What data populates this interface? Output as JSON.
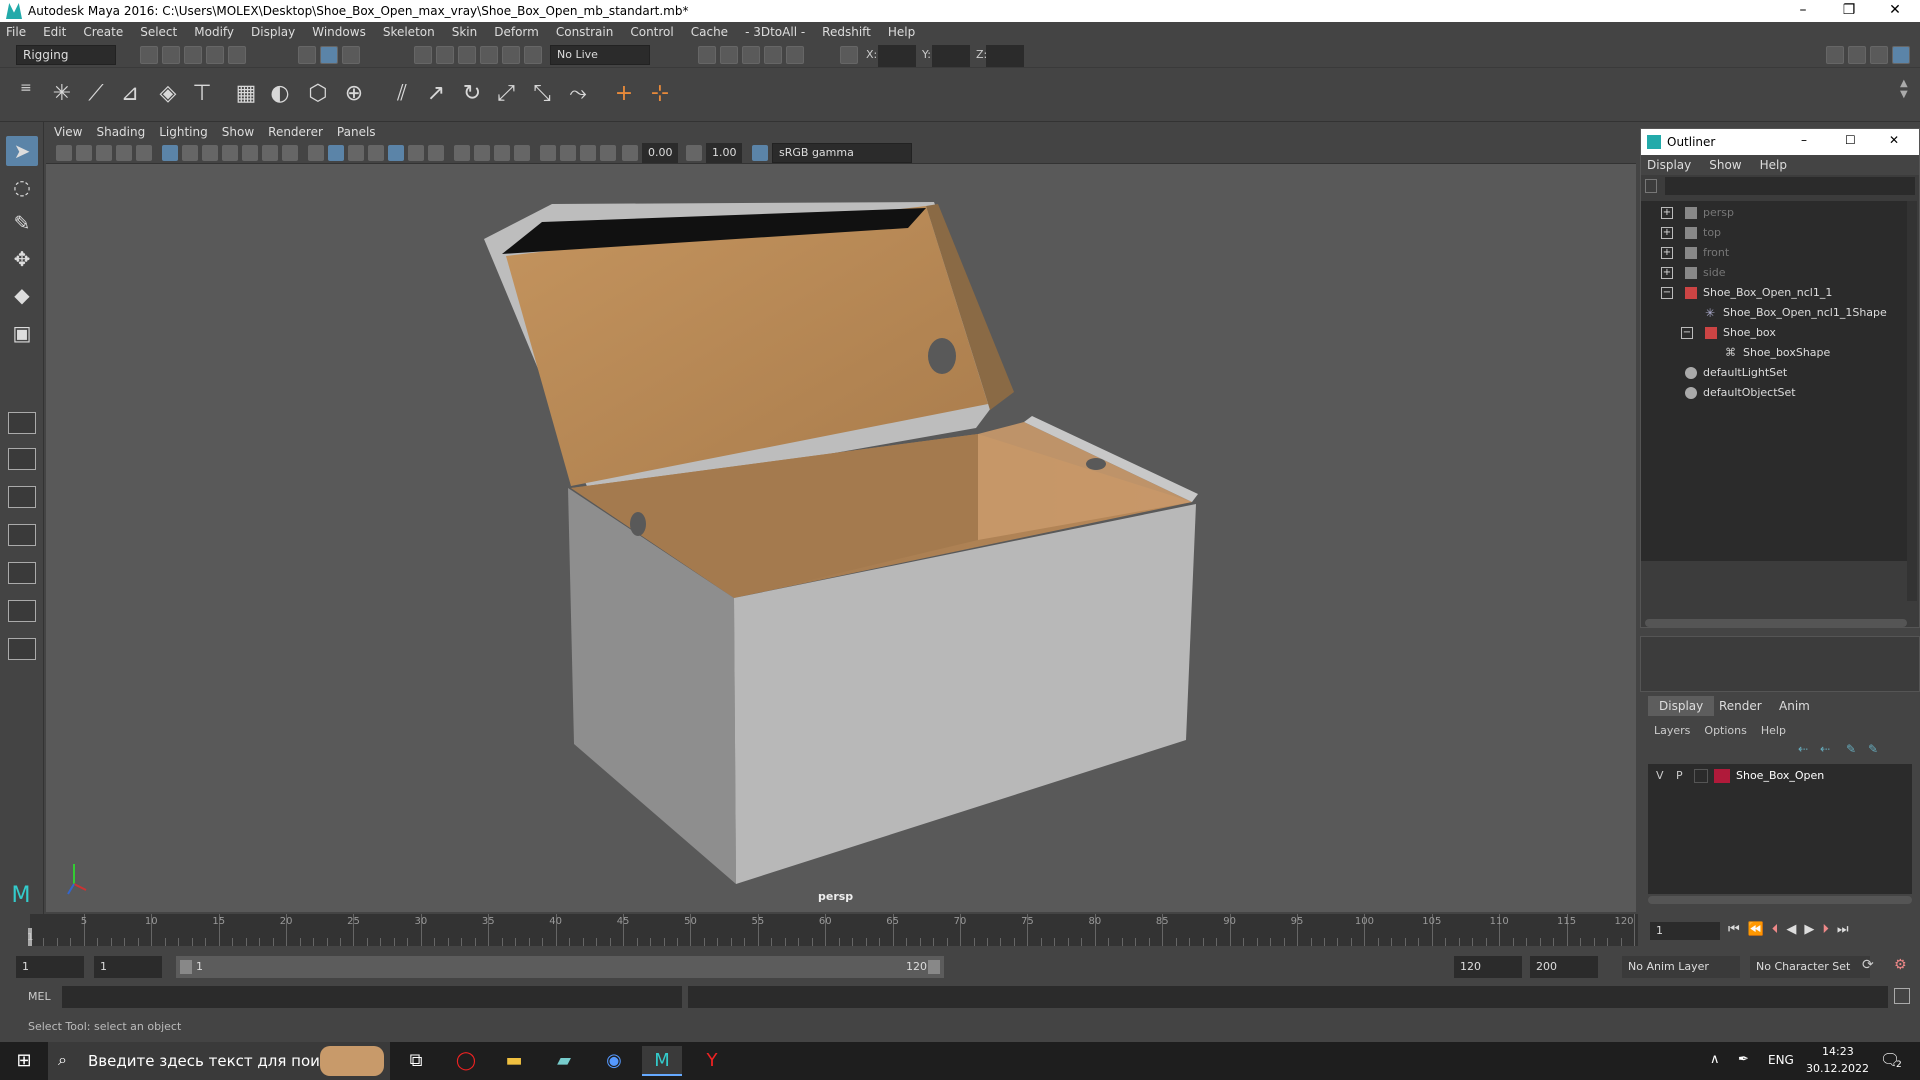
{
  "app": {
    "title": "Autodesk Maya 2016: C:\\Users\\MOLEX\\Desktop\\Shoe_Box_Open_max_vray\\Shoe_Box_Open_mb_standart.mb*",
    "min_icon": "minimize-icon",
    "max_icon": "restore-icon",
    "close_icon": "close-icon"
  },
  "menubar": [
    "File",
    "Edit",
    "Create",
    "Select",
    "Modify",
    "Display",
    "Windows",
    "Skeleton",
    "Skin",
    "Deform",
    "Constrain",
    "Control",
    "Cache",
    "- 3DtoAll -",
    "Redshift",
    "Help"
  ],
  "statusline": {
    "mode": "Rigging",
    "live_surface": "No Live Surface",
    "x_label": "X:",
    "y_label": "Y:",
    "z_label": "Z:"
  },
  "viewport": {
    "menu": [
      "View",
      "Shading",
      "Lighting",
      "Show",
      "Renderer",
      "Panels"
    ],
    "near_value": "0.00",
    "far_value": "1.00",
    "color_space": "sRGB gamma",
    "camera_label": "persp"
  },
  "outliner": {
    "title": "Outliner",
    "menu": [
      "Display",
      "Show",
      "Help"
    ],
    "items": [
      {
        "label": "persp",
        "dim": true,
        "icon": "camera-icon"
      },
      {
        "label": "top",
        "dim": true,
        "icon": "camera-icon"
      },
      {
        "label": "front",
        "dim": true,
        "icon": "camera-icon"
      },
      {
        "label": "side",
        "dim": true,
        "icon": "camera-icon"
      },
      {
        "label": "Shoe_Box_Open_ncl1_1",
        "dim": false,
        "icon": "transform-icon"
      },
      {
        "label": "Shoe_Box_Open_ncl1_1Shape",
        "dim": false,
        "icon": "cluster-icon"
      },
      {
        "label": "Shoe_box",
        "dim": false,
        "icon": "transform-icon"
      },
      {
        "label": "Shoe_boxShape",
        "dim": false,
        "icon": "mesh-icon"
      },
      {
        "label": "defaultLightSet",
        "dim": false,
        "icon": "set-icon"
      },
      {
        "label": "defaultObjectSet",
        "dim": false,
        "icon": "set-icon"
      }
    ]
  },
  "layers": {
    "tabs": [
      "Display",
      "Render",
      "Anim"
    ],
    "menu": [
      "Layers",
      "Options",
      "Help"
    ],
    "row": {
      "v": "V",
      "p": "P",
      "name": "Shoe_Box_Open",
      "color": "#b01a3a"
    }
  },
  "timeline": {
    "ticks": [
      "5",
      "10",
      "15",
      "20",
      "25",
      "30",
      "35",
      "40",
      "45",
      "50",
      "55",
      "60",
      "65",
      "70",
      "75",
      "80",
      "85",
      "90",
      "95",
      "100",
      "105",
      "110",
      "115",
      "120"
    ],
    "start_label": "1",
    "current_frame": "1"
  },
  "range": {
    "start": "1",
    "start2": "1",
    "slider_start": "1",
    "slider_end": "120",
    "end": "120",
    "end2": "200",
    "anim_layer": "No Anim Layer",
    "char_set": "No Character Set"
  },
  "cmdline": {
    "label": "MEL"
  },
  "helpline": "Select Tool: select an object",
  "taskbar": {
    "search_placeholder": "Введите здесь текст для поиска",
    "lang": "ENG",
    "time": "14:23",
    "date": "30.12.2022",
    "notification_count": "2"
  }
}
